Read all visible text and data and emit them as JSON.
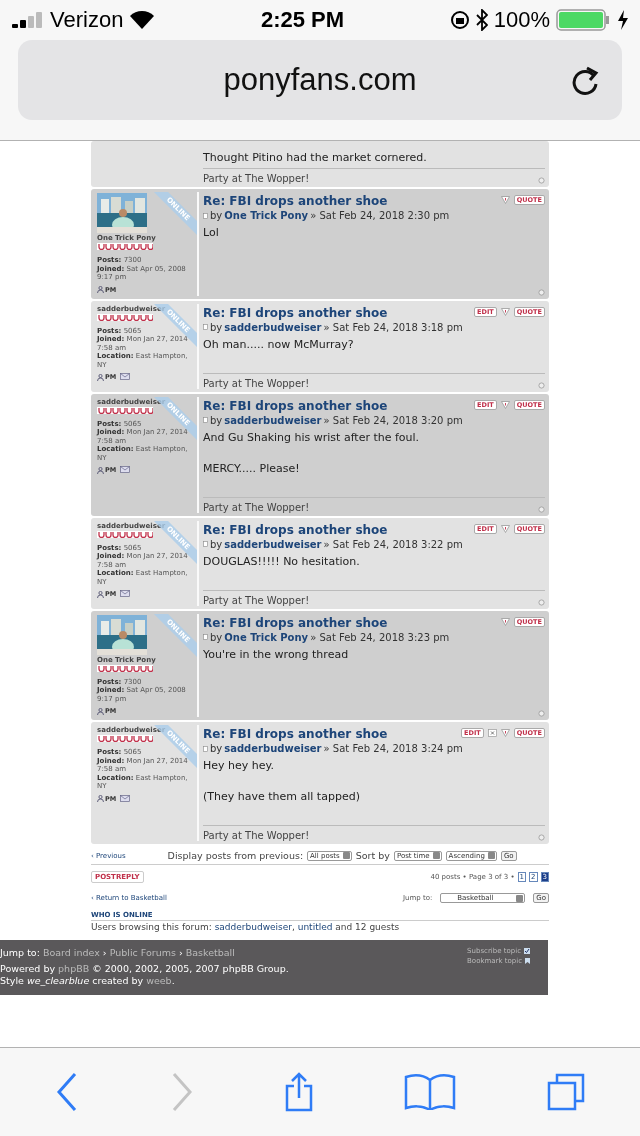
{
  "status_bar": {
    "carrier": "Verizon",
    "time": "2:25 PM",
    "battery": "100%"
  },
  "address_bar": {
    "url": "ponyfans.com"
  },
  "posts": [
    {
      "kind": "partial",
      "shaded": false,
      "body": [
        "Thought Pitino had the market cornered."
      ],
      "signature": "Party at The Wopper!"
    },
    {
      "kind": "full",
      "shaded": true,
      "author": {
        "name": "One Trick Pony",
        "online": "ONLINE",
        "stats": [
          {
            "label": "Posts:",
            "value": "7300"
          },
          {
            "label": "Joined:",
            "value": "Sat Apr 05, 2008 9:17 pm"
          }
        ],
        "contacts": [
          {
            "kind": "pm",
            "label": "PM"
          }
        ]
      },
      "buttons": [
        {
          "kind": "report"
        },
        {
          "kind": "quote",
          "label": "QUOTE"
        }
      ],
      "title": "Re: FBI drops another shoe",
      "by": "by",
      "author_link": "One Trick Pony",
      "date": "» Sat Feb 24, 2018 2:30 pm",
      "body": [
        "Lol"
      ]
    },
    {
      "kind": "full",
      "shaded": false,
      "author": {
        "name": "sadderbudweiser",
        "online": "ONLINE",
        "stats": [
          {
            "label": "Posts:",
            "value": "5065"
          },
          {
            "label": "Joined:",
            "value": "Mon Jan 27, 2014 7:58 am"
          },
          {
            "label": "Location:",
            "value": "East Hampton, NY"
          }
        ],
        "contacts": [
          {
            "kind": "pm",
            "label": "PM"
          },
          {
            "kind": "email"
          }
        ]
      },
      "buttons": [
        {
          "kind": "edit",
          "label": "EDIT"
        },
        {
          "kind": "report"
        },
        {
          "kind": "quote",
          "label": "QUOTE"
        }
      ],
      "title": "Re: FBI drops another shoe",
      "by": "by",
      "author_link": "sadderbudweiser",
      "date": "» Sat Feb 24, 2018 3:18 pm",
      "body": [
        "Oh man..... now McMurray?"
      ],
      "signature": "Party at The Wopper!"
    },
    {
      "kind": "full",
      "shaded": true,
      "author": {
        "name": "sadderbudweiser",
        "online": "ONLINE",
        "stats": [
          {
            "label": "Posts:",
            "value": "5065"
          },
          {
            "label": "Joined:",
            "value": "Mon Jan 27, 2014 7:58 am"
          },
          {
            "label": "Location:",
            "value": "East Hampton, NY"
          }
        ],
        "contacts": [
          {
            "kind": "pm",
            "label": "PM"
          },
          {
            "kind": "email"
          }
        ]
      },
      "buttons": [
        {
          "kind": "edit",
          "label": "EDIT"
        },
        {
          "kind": "report"
        },
        {
          "kind": "quote",
          "label": "QUOTE"
        }
      ],
      "title": "Re: FBI drops another shoe",
      "by": "by",
      "author_link": "sadderbudweiser",
      "date": "» Sat Feb 24, 2018 3:20 pm",
      "body": [
        "And Gu Shaking his wrist after the foul.",
        "MERCY..... Please!"
      ],
      "signature": "Party at The Wopper!"
    },
    {
      "kind": "full",
      "shaded": false,
      "author": {
        "name": "sadderbudweiser",
        "online": "ONLINE",
        "stats": [
          {
            "label": "Posts:",
            "value": "5065"
          },
          {
            "label": "Joined:",
            "value": "Mon Jan 27, 2014 7:58 am"
          },
          {
            "label": "Location:",
            "value": "East Hampton, NY"
          }
        ],
        "contacts": [
          {
            "kind": "pm",
            "label": "PM"
          },
          {
            "kind": "email"
          }
        ]
      },
      "buttons": [
        {
          "kind": "edit",
          "label": "EDIT"
        },
        {
          "kind": "report"
        },
        {
          "kind": "quote",
          "label": "QUOTE"
        }
      ],
      "title": "Re: FBI drops another shoe",
      "by": "by",
      "author_link": "sadderbudweiser",
      "date": "» Sat Feb 24, 2018 3:22 pm",
      "body": [
        "DOUGLAS!!!!! No hesitation."
      ],
      "signature": "Party at The Wopper!"
    },
    {
      "kind": "full",
      "shaded": true,
      "author": {
        "name": "One Trick Pony",
        "online": "ONLINE",
        "stats": [
          {
            "label": "Posts:",
            "value": "7300"
          },
          {
            "label": "Joined:",
            "value": "Sat Apr 05, 2008 9:17 pm"
          }
        ],
        "contacts": [
          {
            "kind": "pm",
            "label": "PM"
          }
        ]
      },
      "buttons": [
        {
          "kind": "report"
        },
        {
          "kind": "quote",
          "label": "QUOTE"
        }
      ],
      "title": "Re: FBI drops another shoe",
      "by": "by",
      "author_link": "One Trick Pony",
      "date": "» Sat Feb 24, 2018 3:23 pm",
      "body": [
        "You're in the wrong thread"
      ]
    },
    {
      "kind": "full",
      "shaded": false,
      "author": {
        "name": "sadderbudweiser",
        "online": "ONLINE",
        "stats": [
          {
            "label": "Posts:",
            "value": "5065"
          },
          {
            "label": "Joined:",
            "value": "Mon Jan 27, 2014 7:58 am"
          },
          {
            "label": "Location:",
            "value": "East Hampton, NY"
          }
        ],
        "contacts": [
          {
            "kind": "pm",
            "label": "PM"
          },
          {
            "kind": "email"
          }
        ]
      },
      "buttons": [
        {
          "kind": "edit",
          "label": "EDIT"
        },
        {
          "kind": "delete"
        },
        {
          "kind": "report"
        },
        {
          "kind": "quote",
          "label": "QUOTE"
        }
      ],
      "title": "Re: FBI drops another shoe",
      "by": "by",
      "author_link": "sadderbudweiser",
      "date": "» Sat Feb 24, 2018 3:24 pm",
      "body": [
        "Hey hey hey.",
        "(They have them all tapped)"
      ],
      "signature": "Party at The Wopper!"
    }
  ],
  "display_bar": {
    "previous": "‹ Previous",
    "display_label": "Display posts from previous:",
    "display_select": "All posts",
    "sort_label": "Sort by",
    "sort_select": "Post time",
    "order_select": "Ascending",
    "go": "Go"
  },
  "pagination": {
    "reply_button": "POSTREPLY",
    "summary": "40 posts • Page 3 of 3 •",
    "pages": [
      {
        "label": "1",
        "selected": false
      },
      {
        "label": "2",
        "selected": false
      },
      {
        "label": "3",
        "selected": true
      }
    ]
  },
  "jump_bar": {
    "return_link": "‹ Return to Basketball",
    "jump_label": "Jump to:",
    "jump_select": "Basketball",
    "go": "Go"
  },
  "who_is_online": {
    "heading": "WHO IS ONLINE",
    "text": "Users browsing this forum: ",
    "users": [
      "sadderbudweiser",
      "untitled"
    ],
    "user_separator": ",",
    "tail": " and 12 guests"
  },
  "footer": {
    "jump_label": "Jump to:",
    "crumbs": [
      "Board index",
      "Public Forums",
      "Basketball"
    ],
    "crumb_separator": "›",
    "actions": [
      {
        "kind": "subscribe",
        "label": "Subscribe topic"
      },
      {
        "kind": "bookmark",
        "label": "Bookmark topic"
      }
    ],
    "powered_prefix": "Powered by ",
    "powered_link": "phpBB",
    "powered_suffix": " © 2000, 2002, 2005, 2007 phpBB Group.",
    "style_prefix": "Style ",
    "style_name": "we_clearblue",
    "style_mid": " created by ",
    "style_author": "weeb",
    "style_suffix": "."
  },
  "toolbar": {
    "back_disabled": false,
    "forward_disabled": true
  }
}
